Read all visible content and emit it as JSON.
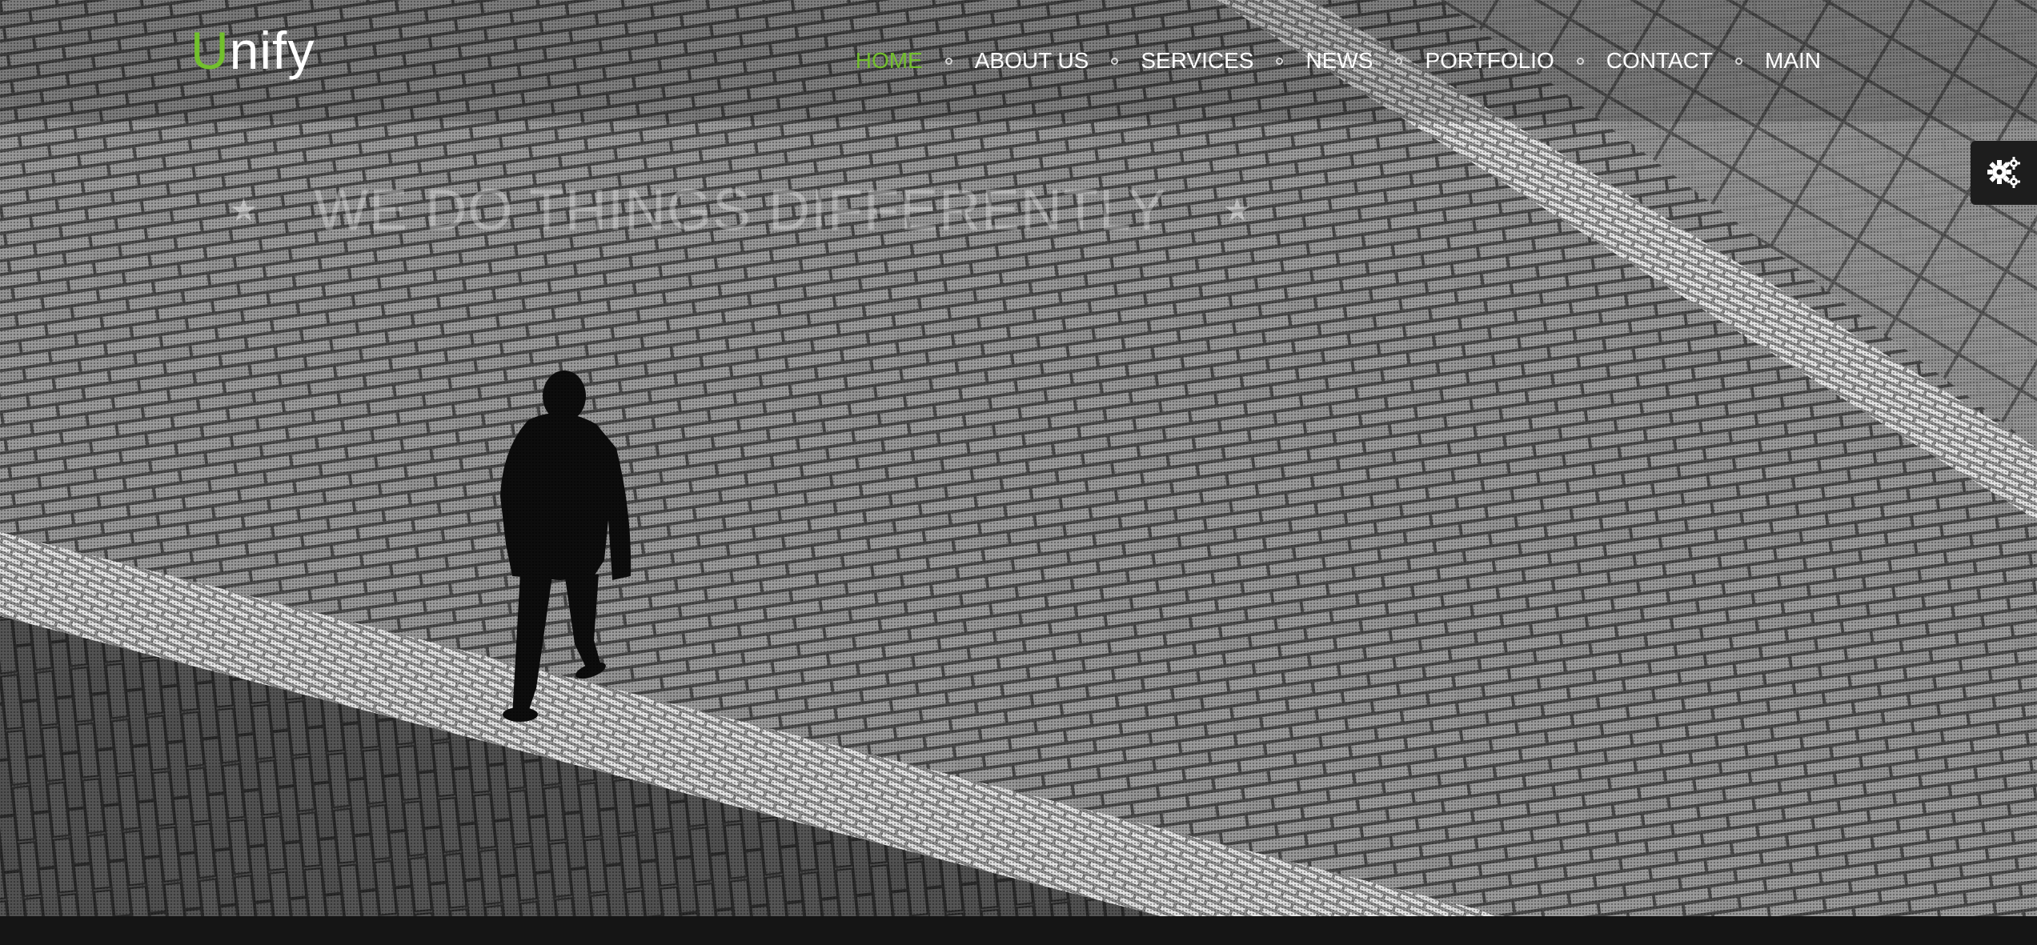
{
  "brand": {
    "logo_first": "U",
    "logo_rest": "nify",
    "accent_color": "#72c02c"
  },
  "nav": {
    "items": [
      {
        "label": "HOME",
        "active": true
      },
      {
        "label": "ABOUT US",
        "active": false
      },
      {
        "label": "SERVICES",
        "active": false
      },
      {
        "label": "NEWS",
        "active": false
      },
      {
        "label": "PORTFOLIO",
        "active": false
      },
      {
        "label": "CONTACT",
        "active": false
      },
      {
        "label": "MAIN",
        "active": false
      }
    ]
  },
  "hero": {
    "headline": "WE DO THINGS DIFFERENTLY",
    "star_icon": "star-icon"
  },
  "settings": {
    "icon": "gears-icon"
  }
}
